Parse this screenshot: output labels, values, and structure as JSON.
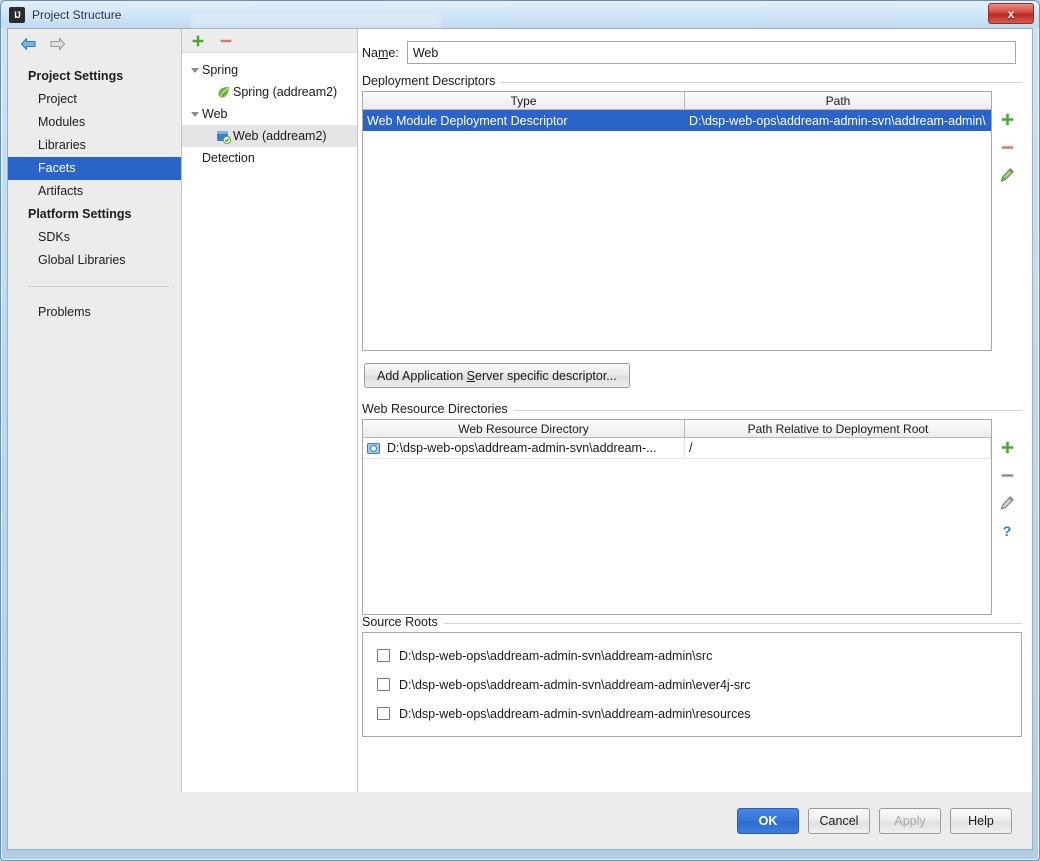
{
  "window": {
    "title": "Project Structure",
    "app_icon": "intellij-idea-icon",
    "close_label": "x"
  },
  "sidebar": {
    "nav": {
      "back_icon": "arrow-left-icon",
      "forward_icon": "arrow-right-icon"
    },
    "groups": [
      {
        "label": "Project Settings",
        "items": [
          {
            "label": "Project",
            "selected": false
          },
          {
            "label": "Modules",
            "selected": false
          },
          {
            "label": "Libraries",
            "selected": false
          },
          {
            "label": "Facets",
            "selected": true
          },
          {
            "label": "Artifacts",
            "selected": false
          }
        ]
      },
      {
        "label": "Platform Settings",
        "items": [
          {
            "label": "SDKs",
            "selected": false
          },
          {
            "label": "Global Libraries",
            "selected": false
          }
        ]
      }
    ],
    "problems": {
      "label": "Problems"
    }
  },
  "tree": {
    "toolbar": {
      "add_icon": "plus-icon",
      "remove_icon": "minus-icon"
    },
    "rows": [
      {
        "label": "Spring",
        "level": 0,
        "expanded": true,
        "icon": null,
        "selected": false
      },
      {
        "label": "Spring (addream2)",
        "level": 1,
        "expanded": null,
        "icon": "spring-leaf-icon",
        "selected": false
      },
      {
        "label": "Web",
        "level": 0,
        "expanded": true,
        "icon": null,
        "selected": false
      },
      {
        "label": "Web (addream2)",
        "level": 1,
        "expanded": null,
        "icon": "web-facet-icon",
        "selected": true
      },
      {
        "label": "Detection",
        "level": 0,
        "expanded": null,
        "icon": null,
        "selected": false
      }
    ]
  },
  "detail": {
    "name_field": {
      "label_pre": "Na",
      "label_mnemonic": "m",
      "label_post": "e:",
      "value": "Web",
      "placeholder": ""
    },
    "deployment_descriptors": {
      "title": "Deployment Descriptors",
      "columns": [
        "Type",
        "Path"
      ],
      "rows": [
        {
          "type": "Web Module Deployment Descriptor",
          "path": "D:\\dsp-web-ops\\addream-admin-svn\\addream-admin\\",
          "selected": true
        }
      ],
      "buttons": [
        {
          "icon": "plus-icon",
          "name": "add-descriptor-button"
        },
        {
          "icon": "minus-icon",
          "name": "remove-descriptor-button"
        },
        {
          "icon": "pencil-edit-icon",
          "name": "edit-descriptor-button"
        }
      ]
    },
    "add_descriptor_button": {
      "text_pre": "Add Application ",
      "text_mnemonic": "S",
      "text_post": "erver specific descriptor..."
    },
    "web_resource_directories": {
      "title": "Web Resource Directories",
      "columns": [
        "Web Resource Directory",
        "Path Relative to Deployment Root"
      ],
      "rows": [
        {
          "icon": "folder-web-icon",
          "directory": "D:\\dsp-web-ops\\addream-admin-svn\\addream-...",
          "relative_path": "/"
        }
      ],
      "buttons": [
        {
          "icon": "plus-icon",
          "name": "add-web-resource-button"
        },
        {
          "icon": "minus-icon",
          "name": "remove-web-resource-button"
        },
        {
          "icon": "pencil-edit-icon",
          "name": "edit-web-resource-button"
        },
        {
          "icon": "question-help-icon",
          "name": "web-resource-help-button"
        }
      ]
    },
    "source_roots": {
      "title": "Source Roots",
      "items": [
        {
          "label": "D:\\dsp-web-ops\\addream-admin-svn\\addream-admin\\src",
          "checked": false
        },
        {
          "label": "D:\\dsp-web-ops\\addream-admin-svn\\addream-admin\\ever4j-src",
          "checked": false
        },
        {
          "label": "D:\\dsp-web-ops\\addream-admin-svn\\addream-admin\\resources",
          "checked": false
        }
      ]
    }
  },
  "footer": {
    "ok": "OK",
    "cancel": "Cancel",
    "apply": "Apply",
    "help": "Help"
  },
  "colors": {
    "selection_blue": "#2a64c8",
    "titlebar_blue": "#cfe4f5",
    "close_red": "#bb2a22",
    "panel_gray": "#ececec",
    "accent_green": "#4aa832"
  }
}
